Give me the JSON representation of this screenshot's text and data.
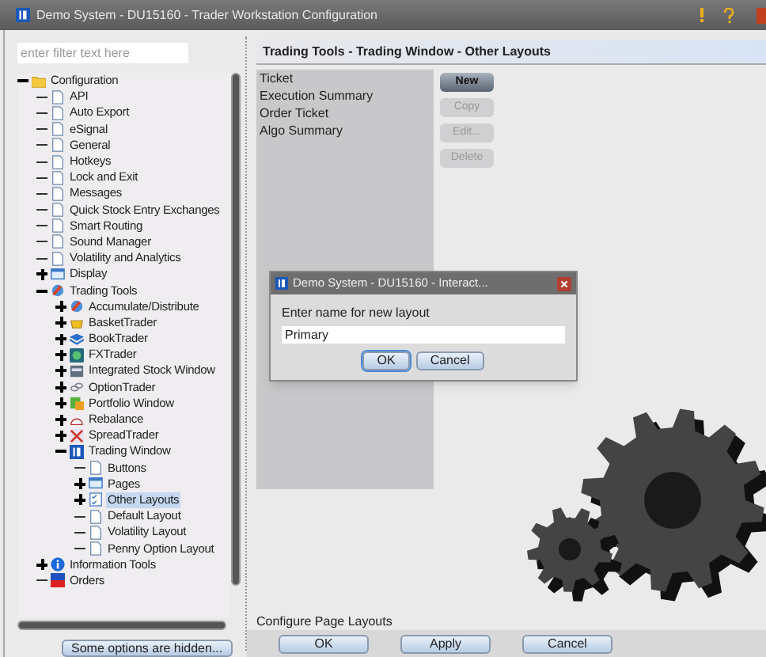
{
  "window": {
    "title": "Demo System - DU15160 - Trader Workstation Configuration"
  },
  "filter": {
    "placeholder": "enter filter text here"
  },
  "tree": [
    {
      "label": "Configuration",
      "kind": "branch",
      "expanded": true,
      "selected": false,
      "children": [
        {
          "label": "API",
          "kind": "leaf",
          "selected": false
        },
        {
          "label": "Auto Export",
          "kind": "leaf",
          "selected": false
        },
        {
          "label": "eSignal",
          "kind": "leaf",
          "selected": false
        },
        {
          "label": "General",
          "kind": "leaf",
          "selected": false
        },
        {
          "label": "Hotkeys",
          "kind": "leaf",
          "selected": false
        },
        {
          "label": "Lock and Exit",
          "kind": "leaf",
          "selected": false
        },
        {
          "label": "Messages",
          "kind": "leaf",
          "selected": false
        },
        {
          "label": "Quick Stock Entry Exchanges",
          "kind": "leaf",
          "selected": false
        },
        {
          "label": "Smart Routing",
          "kind": "leaf",
          "selected": false
        },
        {
          "label": "Sound Manager",
          "kind": "leaf",
          "selected": false
        },
        {
          "label": "Volatility and Analytics",
          "kind": "leaf",
          "selected": false
        },
        {
          "label": "Display",
          "kind": "branch",
          "expanded": false,
          "selected": false
        },
        {
          "label": "Trading Tools",
          "kind": "branch",
          "expanded": true,
          "selected": false,
          "children": [
            {
              "label": "Accumulate/Distribute",
              "kind": "branch",
              "expanded": false,
              "selected": false
            },
            {
              "label": "BasketTrader",
              "kind": "branch",
              "expanded": false,
              "selected": false
            },
            {
              "label": "BookTrader",
              "kind": "branch",
              "expanded": false,
              "selected": false
            },
            {
              "label": "FXTrader",
              "kind": "branch",
              "expanded": false,
              "selected": false
            },
            {
              "label": "Integrated Stock Window",
              "kind": "branch",
              "expanded": false,
              "selected": false
            },
            {
              "label": "OptionTrader",
              "kind": "branch",
              "expanded": false,
              "selected": false
            },
            {
              "label": "Portfolio Window",
              "kind": "branch",
              "expanded": false,
              "selected": false
            },
            {
              "label": "Rebalance",
              "kind": "branch",
              "expanded": false,
              "selected": false
            },
            {
              "label": "SpreadTrader",
              "kind": "branch",
              "expanded": false,
              "selected": false
            },
            {
              "label": "Trading Window",
              "kind": "branch",
              "expanded": true,
              "selected": false,
              "children": [
                {
                  "label": "Buttons",
                  "kind": "leaf",
                  "selected": false
                },
                {
                  "label": "Pages",
                  "kind": "branch",
                  "expanded": false,
                  "selected": false
                },
                {
                  "label": "Other Layouts",
                  "kind": "branch",
                  "expanded": false,
                  "selected": true
                },
                {
                  "label": "Default Layout",
                  "kind": "leaf",
                  "selected": false
                },
                {
                  "label": "Volatility Layout",
                  "kind": "leaf",
                  "selected": false
                },
                {
                  "label": "Penny Option Layout",
                  "kind": "leaf",
                  "selected": false
                }
              ]
            }
          ]
        },
        {
          "label": "Information Tools",
          "kind": "branch",
          "expanded": false,
          "selected": false
        },
        {
          "label": "Orders",
          "kind": "leaf",
          "selected": false
        }
      ]
    }
  ],
  "hidden_options_button": "Some options are hidden...",
  "breadcrumb": "Trading Tools - Trading Window - Other Layouts",
  "layouts": [
    "Ticket",
    "Execution Summary",
    "Order Ticket",
    "Algo Summary"
  ],
  "layout_buttons": [
    {
      "label": "New",
      "disabled": false
    },
    {
      "label": "Copy",
      "disabled": true
    },
    {
      "label": "Edit...",
      "disabled": true
    },
    {
      "label": "Delete",
      "disabled": true
    }
  ],
  "dialog": {
    "title": "Demo System - DU15160 - Interact...",
    "prompt": "Enter name for new layout",
    "value": "Primary",
    "buttons": [
      {
        "label": "OK",
        "selected": true
      },
      {
        "label": "Cancel",
        "selected": false
      }
    ]
  },
  "status": "Configure Page Layouts",
  "footer_buttons": [
    "OK",
    "Apply",
    "Cancel"
  ]
}
